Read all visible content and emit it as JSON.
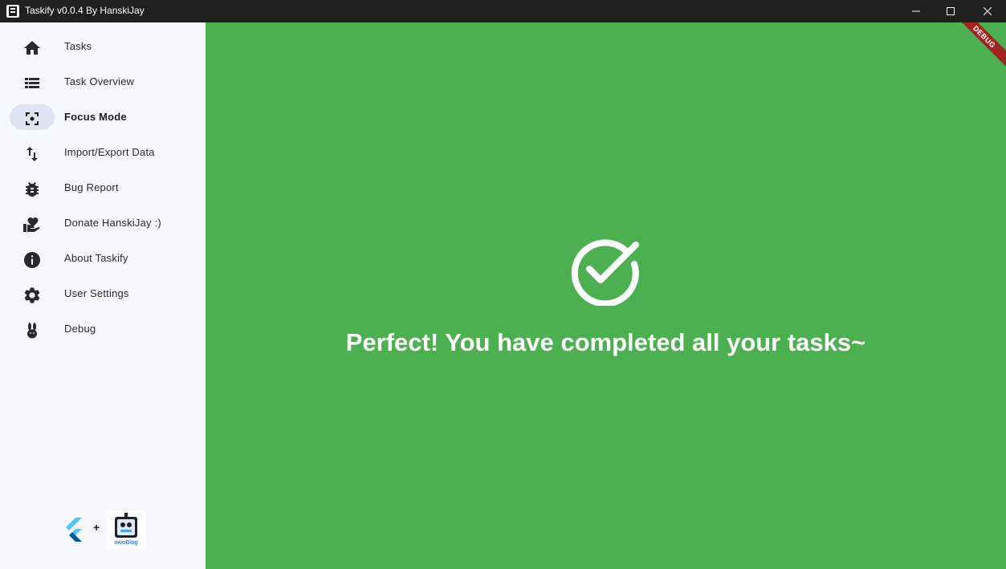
{
  "window": {
    "title": "Taskify v0.0.4 By HanskiJay"
  },
  "sidebar": {
    "items": [
      {
        "label": "Tasks",
        "icon": "home-icon"
      },
      {
        "label": "Task Overview",
        "icon": "list-icon"
      },
      {
        "label": "Focus Mode",
        "icon": "center-focus-icon",
        "selected": true
      },
      {
        "label": "Import/Export Data",
        "icon": "import-export-icon"
      },
      {
        "label": "Bug Report",
        "icon": "bug-icon"
      },
      {
        "label": "Donate HanskiJay :)",
        "icon": "volunteer-heart-icon"
      },
      {
        "label": "About Taskify",
        "icon": "info-icon"
      },
      {
        "label": "User Settings",
        "icon": "gear-icon"
      },
      {
        "label": "Debug",
        "icon": "bunny-icon"
      }
    ],
    "footer": {
      "plus": "+",
      "blog_logo_text": "owoBlog"
    }
  },
  "main": {
    "message": "Perfect! You have completed all your tasks~",
    "debug_banner": "DEBUG",
    "background": "#4caf50"
  },
  "colors": {
    "sidebar_bg": "#f7f8fd",
    "selected_pill": "#dde4f3",
    "titlebar_bg": "#202020",
    "success_green": "#4caf50",
    "debug_red": "#a32424"
  }
}
